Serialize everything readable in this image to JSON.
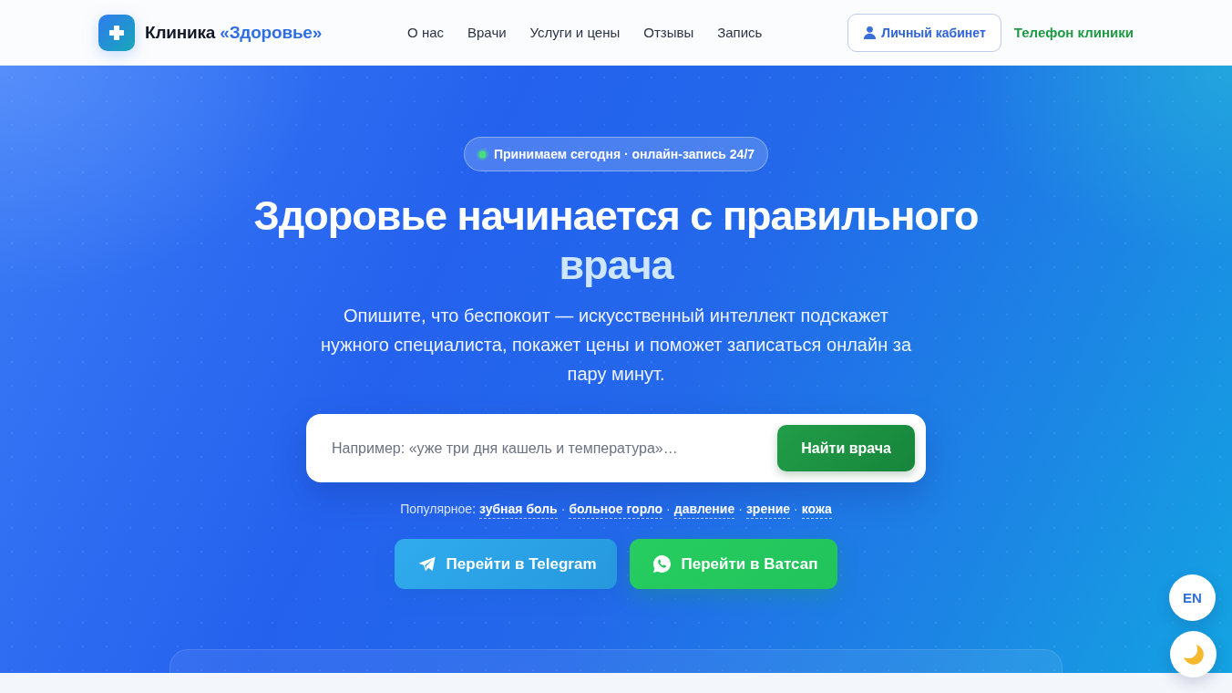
{
  "header": {
    "brand": {
      "name": "Клиника",
      "accent": "«Здоровье»"
    },
    "nav": [
      {
        "label": "О нас"
      },
      {
        "label": "Врачи"
      },
      {
        "label": "Услуги и цены"
      },
      {
        "label": "Отзывы"
      },
      {
        "label": "Запись"
      }
    ],
    "account_button": {
      "label": "Личный кабинет"
    },
    "phone_link": {
      "label": "Телефон клиники"
    }
  },
  "hero": {
    "badge": {
      "text": "Принимаем сегодня · онлайн-запись 24/7"
    },
    "title": {
      "text": "Здоровье начинается с правильного",
      "accent": "врача"
    },
    "subtitle": "Опишите, что беспокоит — искусственный интеллект подскажет нужного специалиста, покажет цены и поможет записаться онлайн за пару минут.",
    "search": {
      "placeholder": "Например: «уже три дня кашель и температура»…",
      "button": "Найти врача"
    },
    "popular": {
      "label": "Популярное:",
      "separator": "·",
      "items": [
        "зубная боль",
        "больное горло",
        "давление",
        "зрение",
        "кожа"
      ]
    },
    "messengers": [
      {
        "kind": "telegram",
        "label": "Перейти в Telegram"
      },
      {
        "kind": "whatsapp",
        "label": "Перейти в Ватсап"
      }
    ]
  },
  "floating": {
    "language_button": "EN"
  }
}
